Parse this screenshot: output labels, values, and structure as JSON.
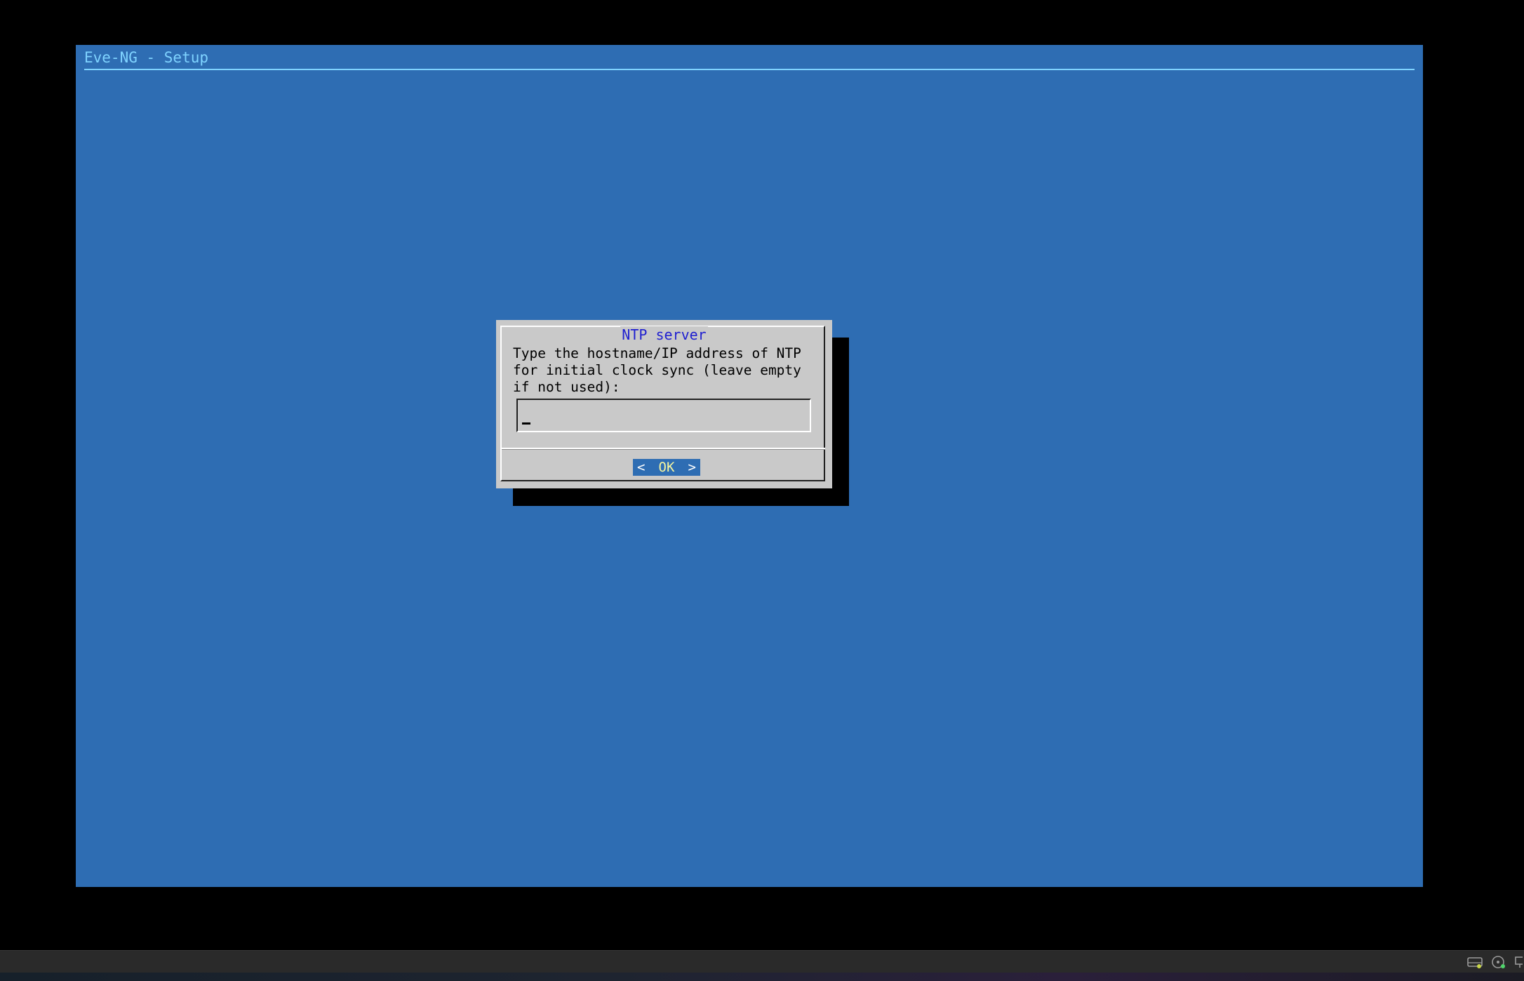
{
  "console": {
    "backtitle": "Eve-NG - Setup",
    "background_color": "#2e6db3",
    "backtitle_color": "#7fd3ff"
  },
  "dialog": {
    "title": "NTP server",
    "prompt": "Type the hostname/IP address of NTP\nfor initial clock sync (leave empty\nif not used):",
    "input_value": "",
    "ok_label": "OK",
    "ok_left_arrow": "<",
    "ok_right_arrow": ">",
    "background_color": "#c9c9c9",
    "title_color": "#1f1fd0"
  },
  "host_status_bar": {
    "icons": [
      "hard-disk-icon",
      "optical-drive-icon",
      "network-icon"
    ]
  }
}
